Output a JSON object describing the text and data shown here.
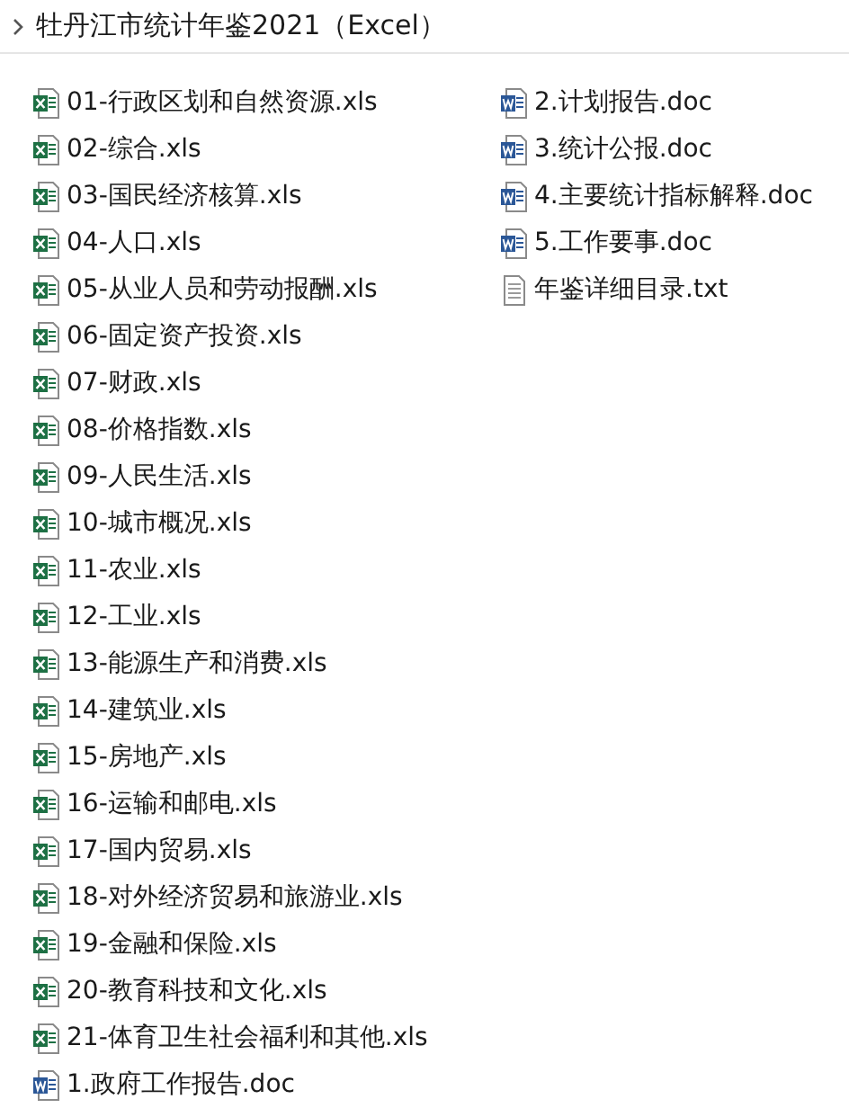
{
  "folder": {
    "title": "牡丹江市统计年鉴2021（Excel）"
  },
  "files": [
    {
      "name": "01-行政区划和自然资源.xls",
      "kind": "xls"
    },
    {
      "name": "02-综合.xls",
      "kind": "xls"
    },
    {
      "name": "03-国民经济核算.xls",
      "kind": "xls"
    },
    {
      "name": "04-人口.xls",
      "kind": "xls"
    },
    {
      "name": "05-从业人员和劳动报酬.xls",
      "kind": "xls"
    },
    {
      "name": "06-固定资产投资.xls",
      "kind": "xls"
    },
    {
      "name": "07-财政.xls",
      "kind": "xls"
    },
    {
      "name": "08-价格指数.xls",
      "kind": "xls"
    },
    {
      "name": "09-人民生活.xls",
      "kind": "xls"
    },
    {
      "name": "10-城市概况.xls",
      "kind": "xls"
    },
    {
      "name": "11-农业.xls",
      "kind": "xls"
    },
    {
      "name": "12-工业.xls",
      "kind": "xls"
    },
    {
      "name": "13-能源生产和消费.xls",
      "kind": "xls"
    },
    {
      "name": "14-建筑业.xls",
      "kind": "xls"
    },
    {
      "name": "15-房地产.xls",
      "kind": "xls"
    },
    {
      "name": "16-运输和邮电.xls",
      "kind": "xls"
    },
    {
      "name": "17-国内贸易.xls",
      "kind": "xls"
    },
    {
      "name": "18-对外经济贸易和旅游业.xls",
      "kind": "xls"
    },
    {
      "name": "19-金融和保险.xls",
      "kind": "xls"
    },
    {
      "name": "20-教育科技和文化.xls",
      "kind": "xls"
    },
    {
      "name": "21-体育卫生社会福利和其他.xls",
      "kind": "xls"
    },
    {
      "name": "1.政府工作报告.doc",
      "kind": "doc"
    },
    {
      "name": "2.计划报告.doc",
      "kind": "doc"
    },
    {
      "name": "3.统计公报.doc",
      "kind": "doc"
    },
    {
      "name": "4.主要统计指标解释.doc",
      "kind": "doc"
    },
    {
      "name": "5.工作要事.doc",
      "kind": "doc"
    },
    {
      "name": "年鉴详细目录.txt",
      "kind": "txt"
    }
  ]
}
